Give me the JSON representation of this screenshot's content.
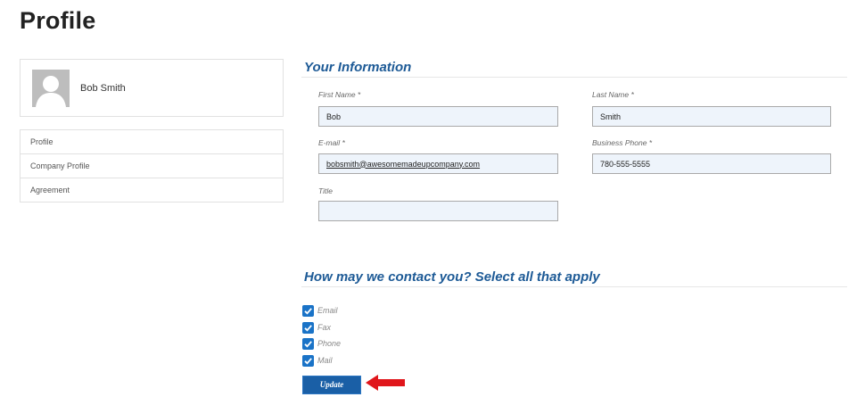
{
  "page": {
    "title": "Profile"
  },
  "sidebar": {
    "user_name": "Bob Smith",
    "items": [
      {
        "label": "Profile"
      },
      {
        "label": "Company Profile"
      },
      {
        "label": "Agreement"
      }
    ]
  },
  "your_information": {
    "heading": "Your Information",
    "fields": {
      "first_name": {
        "label": "First Name *",
        "value": "Bob"
      },
      "last_name": {
        "label": "Last Name *",
        "value": "Smith"
      },
      "email": {
        "label": "E-mail *",
        "value": "bobsmith@awesomemadeupcompany.com"
      },
      "business_phone": {
        "label": "Business Phone *",
        "value": "780-555-5555"
      },
      "title": {
        "label": "Title",
        "value": ""
      }
    }
  },
  "contact": {
    "heading": "How may we contact you? Select all that apply",
    "options": [
      {
        "label": "Email",
        "checked": true
      },
      {
        "label": "Fax",
        "checked": true
      },
      {
        "label": "Phone",
        "checked": true
      },
      {
        "label": "Mail",
        "checked": true
      }
    ]
  },
  "actions": {
    "update_label": "Update"
  },
  "colors": {
    "accent": "#1d5a96",
    "button": "#1a5fa6",
    "checkbox": "#1a73c7",
    "arrow": "#e0161b",
    "input_bg": "#eef4fb"
  }
}
